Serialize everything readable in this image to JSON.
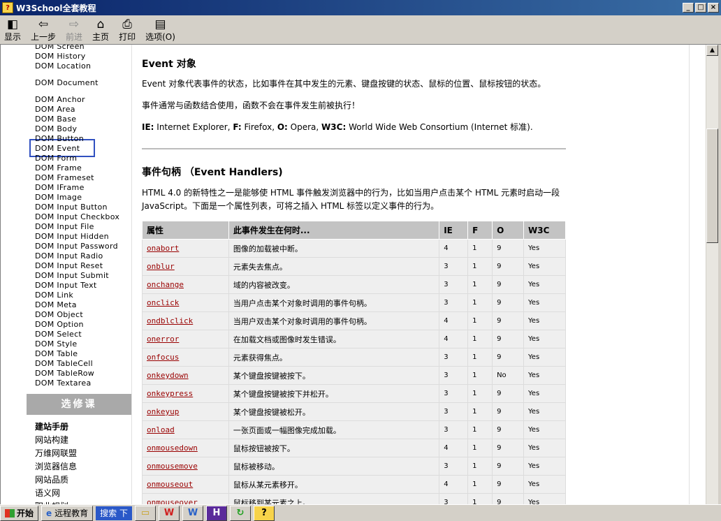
{
  "window": {
    "title": "W3School全套教程"
  },
  "toolbar": [
    {
      "label": "显示",
      "icon": "show-icon",
      "glyph": "◧",
      "enabled": true
    },
    {
      "label": "上一步",
      "icon": "back-arrow-icon",
      "glyph": "⇦",
      "enabled": true
    },
    {
      "label": "前进",
      "icon": "forward-arrow-icon",
      "glyph": "⇨",
      "enabled": false
    },
    {
      "label": "主页",
      "icon": "home-icon",
      "glyph": "⌂",
      "enabled": true
    },
    {
      "label": "打印",
      "icon": "printer-icon",
      "glyph": "⎙",
      "enabled": true
    },
    {
      "label": "选项(O)",
      "icon": "options-icon",
      "glyph": "▤",
      "enabled": true
    }
  ],
  "sidebar": {
    "links": [
      "DOM Screen",
      "DOM History",
      "DOM Location",
      "DOM Document",
      "DOM Anchor",
      "DOM Area",
      "DOM Base",
      "DOM Body",
      "DOM Button",
      "DOM Event",
      "DOM Form",
      "DOM Frame",
      "DOM Frameset",
      "DOM IFrame",
      "DOM Image",
      "DOM Input Button",
      "DOM Input Checkbox",
      "DOM Input File",
      "DOM Input Hidden",
      "DOM Input Password",
      "DOM Input Radio",
      "DOM Input Reset",
      "DOM Input Submit",
      "DOM Input Text",
      "DOM Link",
      "DOM Meta",
      "DOM Object",
      "DOM Option",
      "DOM Select",
      "DOM Style",
      "DOM Table",
      "DOM TableCell",
      "DOM TableRow",
      "DOM Textarea"
    ],
    "elective_title": "选修课",
    "cn_heading": "建站手册",
    "cn_links": [
      "网站构建",
      "万维网联盟",
      "浏览器信息",
      "网站品质",
      "语义网",
      "职业规划"
    ]
  },
  "main": {
    "title1": "Event 对象",
    "p1": "Event 对象代表事件的状态，比如事件在其中发生的元素、键盘按键的状态、鼠标的位置、鼠标按钮的状态。",
    "p2": "事件通常与函数结合使用，函数不会在事件发生前被执行！",
    "legend": {
      "ie_b": "IE:",
      "ie": " Internet Explorer, ",
      "f_b": "F:",
      "f": " Firefox, ",
      "o_b": "O:",
      "o": " Opera, ",
      "w_b": "W3C:",
      "w": " World Wide Web Consortium (Internet 标准)."
    },
    "title2": "事件句柄 （Event Handlers)",
    "p3": "HTML 4.0 的新特性之一是能够使 HTML 事件触发浏览器中的行为，比如当用户点击某个 HTML 元素时启动一段 JavaScript。下面是一个属性列表，可将之插入 HTML 标签以定义事件的行为。",
    "table": {
      "headers": [
        "属性",
        "此事件发生在何时...",
        "IE",
        "F",
        "O",
        "W3C"
      ],
      "rows": [
        [
          "onabort",
          "图像的加载被中断。",
          "4",
          "1",
          "9",
          "Yes"
        ],
        [
          "onblur",
          "元素失去焦点。",
          "3",
          "1",
          "9",
          "Yes"
        ],
        [
          "onchange",
          "域的内容被改变。",
          "3",
          "1",
          "9",
          "Yes"
        ],
        [
          "onclick",
          "当用户点击某个对象时调用的事件句柄。",
          "3",
          "1",
          "9",
          "Yes"
        ],
        [
          "ondblclick",
          "当用户双击某个对象时调用的事件句柄。",
          "4",
          "1",
          "9",
          "Yes"
        ],
        [
          "onerror",
          "在加载文档或图像时发生错误。",
          "4",
          "1",
          "9",
          "Yes"
        ],
        [
          "onfocus",
          "元素获得焦点。",
          "3",
          "1",
          "9",
          "Yes"
        ],
        [
          "onkeydown",
          "某个键盘按键被按下。",
          "3",
          "1",
          "No",
          "Yes"
        ],
        [
          "onkeypress",
          "某个键盘按键被按下并松开。",
          "3",
          "1",
          "9",
          "Yes"
        ],
        [
          "onkeyup",
          "某个键盘按键被松开。",
          "3",
          "1",
          "9",
          "Yes"
        ],
        [
          "onload",
          "一张页面或一幅图像完成加载。",
          "3",
          "1",
          "9",
          "Yes"
        ],
        [
          "onmousedown",
          "鼠标按钮被按下。",
          "4",
          "1",
          "9",
          "Yes"
        ],
        [
          "onmousemove",
          "鼠标被移动。",
          "3",
          "1",
          "9",
          "Yes"
        ],
        [
          "onmouseout",
          "鼠标从某元素移开。",
          "4",
          "1",
          "9",
          "Yes"
        ],
        [
          "onmouseover",
          "鼠标移到某元素之上。",
          "3",
          "1",
          "9",
          "Yes"
        ]
      ]
    }
  },
  "taskbar": {
    "start": "开始",
    "task": "远程教育",
    "search": "搜索 下"
  }
}
